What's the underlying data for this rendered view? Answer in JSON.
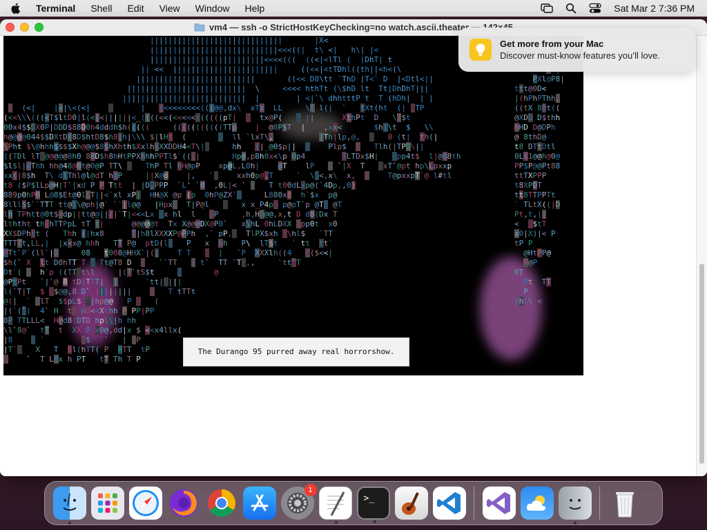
{
  "menubar": {
    "app_name": "Terminal",
    "items": [
      "Shell",
      "Edit",
      "View",
      "Window",
      "Help"
    ],
    "datetime": "Sat Mar 2  7:36 PM"
  },
  "window": {
    "title": "vm4 — ssh -o StrictHostKeyChecking=no watch.ascii.theater — 142×45"
  },
  "terminal": {
    "subtitle": "The Durango 95 purred away real horrorshow.",
    "ascii_rows": [
      "                                |||||||||||||||||||||||||||||       |X<",
      "                                ||||||||||||||||||||||||||||<<<((|  t\\ <|   h\\| |<",
      "                                |||||||||||||||||||||||||<<<<(((  ((<|<lTl (  (DhT| t",
      "                              || <<  |||||||||||||||||||||||     ((<<|<tTDhl((th||<h<(\\",
      "                             ||||||||||||||||||||||||||       ((<< D8\\tt `ThD |T<` D  |<Dtl<||",
      "                           ||||||||||||||||||||||||||  \\     <<<< hthTt (\\$hD lt  Tt|DhDhT|||",
      "                          |||||||||||||||||||||||||||  |        | <|`\\ dhhtttP t  T (hDh|  | |",
      "    (<|    |<|\\<(<|           |   |<<<<<<<<(((@@,dx\\  xTx  LL     \\( l(|  `   tXt(ht  (|  TP",
      "(<<\\\\\\(((<T$ltD0|l(<|<||||||<_((((<<(<<<<<((((((pT|     tx@P(     ||      XthPt  D   \\T$t",
      "00x4$$DX0P|DDD$88D0h4dddh$h(((((     (((((((((((TTp    |  @8P$T  |    ,xx<       $h|\\t  $   \\\\",
      "h@@@@044$$DXtDX8D$htD8$h8|h|\\\\\\ $|lHt  (          ll `lxT\\,          |Th|lp,@,      8 (t|  th(|",
      "\\Pht $\\@hhh$$$$Xh@@@$8$hXhth$Xxlh\\XXDDH4<T\\|      hh   (|_@0$p||       Plp$      Tlh(|TPD\\||",
      "((TDl lT @@@@@8h0 88D$h8hHtPPXhhhPPTl$`(( |       Hp@,pBh0x<\\p 0p4        TLTDx$H|    pp4t$  l|@$8th",
      "$l$l|@Thh hh@48@8t@0@P TT\\     ThP Tl hH@pP    xp@L,L0h|    @T    lP     `|X  T    xT`@pt hp\\Lpxxp",
      "xx(|8$h  T\\ dlThl@l@dT h@P     ||X@d    |,   `     xxh0p@,T     `  \\ <,x\\  x,       T@pxxpT`@ l#tl",
      "t8 ($P$lLp@H|T`|xd P P Ttt  | |D,PPP  `L' `0  ,0L|< `     T t00dLxp@(`4Dp,,0)",
      "889p0hP0 L@8$Et@0lLT||<`xl xP|  HH@X @p (p  0hP@ZX`      L880x8  h`$x  p@",
      "8lll$$``TTT tt@l\\@ph|@` ``|l@@   |Hpx   T|P@l       x x_P4p  p@pT`p @T  @T",
      "lh TPhtt@0t$@dp||tt@@||(|`T|<<<Lx  x hl  l    P     ,h,Hh@@,x,t D d8(Dx T",
      "lththt th(hTTPpL tT t|      @@@@@t  Tx X@@@DX@P0`   x\\hL 0hLDXX  pp0t  x0",
      "XX$DPhtt (   Thh (|hx8      T|h8lXXXXP@PPh  ,` pP,   TlPX$xh  \\hl$   `TT",
      "TTTTt,LL,|  |x<x@ hhh   TT P@  ptD(l    P   x  hh   P\\  lT$t   ` tt  tt`",
      "PTt`P`(ll`|D     08   t008@HHX`|(|    T T      |   `P  XXXlh((4    ($<<|",
      "$h(` X  lt D0hTT`T ` Tt@T8 D      ``TT     t`  TT `T ,,     `tt`T",
      "Dt`(    h`p ((TT t\\l  `  |(T`tS$t             @",
      "@PtPt   `|`@ 8 tD|TTT|  |      `tt| |||",
      "l(`T|T  $  $@@,8 D` ||||||||        T tTTt",
      "@(|  `  lT  $$pL$``|hp@@   P     (",
      "|(`(`(  4` H  t  Hd<<Xthh P PP|PP",
      "8P TTLLL<  H@d8(DTD hpl\\|h hh",
      "\\l`8@`  tT  t  XX P x0@,dd|x $ <<x4llx(",
      "|8      `        `$  ``   |  P",
      "|T`    X   T  8l(hTT( P  HTT  tP",
      "     `  T L0x h PT   tT Th T P"
    ],
    "ascii_rows_right": [
      "",
      "",
      "",
      "",
      "TTtPP$(l",
      "  hDhPht",
      "  thP8DXl",
      "  tt DPlh|",
      "    PXl@P8|",
      "ttt@0D<",
      "|(hPhPThh,",
      "((tX 88t((",
      "@XDD D$thh",
      "hHD D@DPh",
      "@ 8thD@",
      "t8 DTtDtl",
      "0Ll1@@h@0@",
      "PP$P@@Pt88",
      "ttTXPPP",
      "t8XPDT",
      "tt8TTPPTt",
      "` TLtX((|D",
      "Pt,t,||",
      "<   $tT",
      "x0|X)|< P",
      "tP P",
      "  @HtPP@",
      "  P@P",
      "0T",
      "  Pt  TT",
      "  P",
      "(hl\\ <"
    ],
    "scrollbar_thumb_position_pct": 52
  },
  "notification": {
    "title": "Get more from your Mac",
    "body": "Discover must-know features you’ll love."
  },
  "dock": {
    "apps": [
      {
        "name": "finder",
        "running": true
      },
      {
        "name": "launchpad",
        "running": false
      },
      {
        "name": "safari",
        "running": false
      },
      {
        "name": "firefox",
        "running": false
      },
      {
        "name": "chrome",
        "running": false
      },
      {
        "name": "app-store",
        "running": false
      },
      {
        "name": "system-settings",
        "running": false,
        "badge": "1"
      },
      {
        "name": "textedit",
        "running": true
      },
      {
        "name": "terminal",
        "running": true
      },
      {
        "name": "garageband",
        "running": false
      },
      {
        "name": "vscode",
        "running": false
      },
      {
        "name": "visual-studio",
        "running": false
      },
      {
        "name": "weather",
        "running": false
      },
      {
        "name": "migration-assistant",
        "running": true
      },
      {
        "name": "trash",
        "running": false
      }
    ]
  }
}
